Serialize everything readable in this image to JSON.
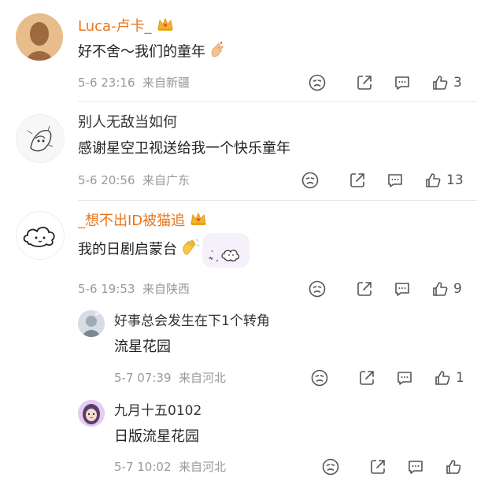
{
  "comments": [
    {
      "username": "Luca-卢卡_",
      "text": "好不舍～我们的童年",
      "time": "5-6 23:16",
      "location": "来自新疆",
      "likes": "3",
      "badge": "crown-icon",
      "emoji": "finger-heart"
    },
    {
      "username": "别人无敌当如何",
      "text": "感谢星空卫视送给我一个快乐童年",
      "time": "5-6 20:56",
      "location": "来自广东",
      "likes": "13"
    },
    {
      "username": "_想不出ID被猫追",
      "text": "我的日剧启蒙台",
      "time": "5-6 19:53",
      "location": "来自陕西",
      "likes": "9",
      "badge": "crown-icon",
      "emoji": "waving-hand",
      "sticker": "cloud-sticker"
    }
  ],
  "replies": [
    {
      "username": "好事总会发生在下1个转角",
      "text": "流星花园",
      "time": "5-7 07:39",
      "location": "来自河北",
      "likes": "1"
    },
    {
      "username": "九月十五0102",
      "text": "日版流星花园",
      "time": "5-7 10:02",
      "location": "来自河北",
      "likes": ""
    }
  ],
  "colors": {
    "vip_name": "#e8761a",
    "meta_gray": "#999999"
  }
}
